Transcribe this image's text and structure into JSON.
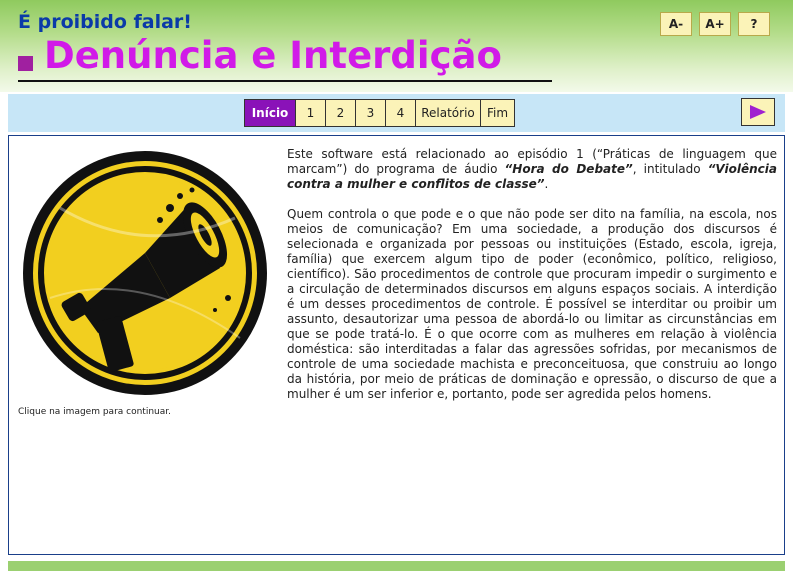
{
  "header": {
    "subtitle": "É proibido falar!",
    "title": "Denúncia e Interdição",
    "font_buttons": {
      "decrease": "A-",
      "increase": "A+",
      "help": "?"
    }
  },
  "nav": {
    "tabs": [
      {
        "label": "Início",
        "active": true
      },
      {
        "label": "1",
        "active": false
      },
      {
        "label": "2",
        "active": false
      },
      {
        "label": "3",
        "active": false
      },
      {
        "label": "4",
        "active": false
      },
      {
        "label": "Relatório",
        "active": false
      },
      {
        "label": "Fim",
        "active": false
      }
    ],
    "next_icon": "play-arrow-icon"
  },
  "content": {
    "image_icon": "megaphone-icon",
    "caption": "Clique na imagem para continuar.",
    "p1_a": "Este software está relacionado ao episódio 1 (“Práticas de linguagem que marcam”) do programa de áudio ",
    "p1_b": "“Hora do Debate”",
    "p1_c": ", intitulado ",
    "p1_d": "“Violência contra a mulher e conflitos de classe”",
    "p1_e": ".",
    "p2": "Quem controla o que pode e o que não pode ser dito na família, na escola, nos meios de comunicação? Em uma sociedade, a produção dos discursos é selecionada e organizada por pessoas ou instituições (Estado, escola, igreja, família) que exercem algum tipo de poder (econômico, político, religioso, científico). São procedimentos de controle que procuram impedir o surgimento e a circulação de determinados discursos em alguns espaços sociais. A interdição é um desses procedimentos de controle. É possível se interditar ou proibir um assunto, desautorizar uma pessoa de abordá-lo ou limitar as circunstâncias em que se pode tratá-lo. É o que ocorre com as mulheres em relação à violência doméstica: são interditadas a falar das agressões sofridas, por mecanismos de controle de uma sociedade machista e preconceituosa, que construiu ao longo da história, por meio de práticas de dominação e opressão, o discurso de que a mulher é um ser inferior e, portanto, pode ser agredida pelos homens."
  },
  "colors": {
    "title": "#d11ae8",
    "subtitle": "#0a3aa8",
    "active_tab": "#8a12b8",
    "button_bg": "#fbf3b8",
    "nav_bg": "#c7e6f7",
    "header_green": "#8fca5e",
    "megaphone_yellow": "#f2cf1f"
  }
}
